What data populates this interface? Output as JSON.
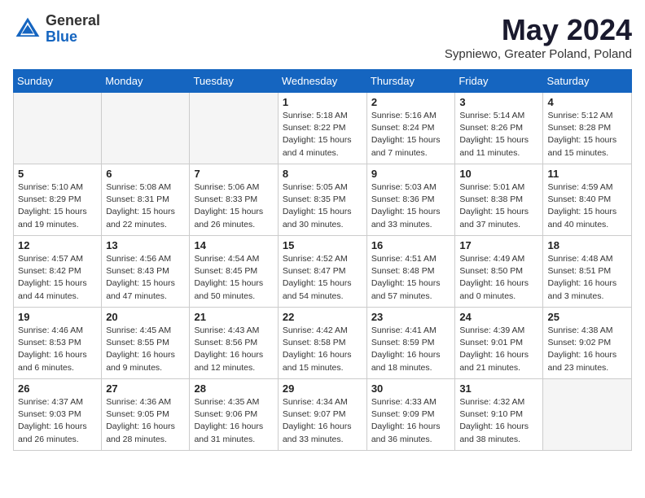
{
  "header": {
    "logo_general": "General",
    "logo_blue": "Blue",
    "month_title": "May 2024",
    "location": "Sypniewo, Greater Poland, Poland"
  },
  "weekdays": [
    "Sunday",
    "Monday",
    "Tuesday",
    "Wednesday",
    "Thursday",
    "Friday",
    "Saturday"
  ],
  "weeks": [
    [
      {
        "day": "",
        "info": ""
      },
      {
        "day": "",
        "info": ""
      },
      {
        "day": "",
        "info": ""
      },
      {
        "day": "1",
        "info": "Sunrise: 5:18 AM\nSunset: 8:22 PM\nDaylight: 15 hours\nand 4 minutes."
      },
      {
        "day": "2",
        "info": "Sunrise: 5:16 AM\nSunset: 8:24 PM\nDaylight: 15 hours\nand 7 minutes."
      },
      {
        "day": "3",
        "info": "Sunrise: 5:14 AM\nSunset: 8:26 PM\nDaylight: 15 hours\nand 11 minutes."
      },
      {
        "day": "4",
        "info": "Sunrise: 5:12 AM\nSunset: 8:28 PM\nDaylight: 15 hours\nand 15 minutes."
      }
    ],
    [
      {
        "day": "5",
        "info": "Sunrise: 5:10 AM\nSunset: 8:29 PM\nDaylight: 15 hours\nand 19 minutes."
      },
      {
        "day": "6",
        "info": "Sunrise: 5:08 AM\nSunset: 8:31 PM\nDaylight: 15 hours\nand 22 minutes."
      },
      {
        "day": "7",
        "info": "Sunrise: 5:06 AM\nSunset: 8:33 PM\nDaylight: 15 hours\nand 26 minutes."
      },
      {
        "day": "8",
        "info": "Sunrise: 5:05 AM\nSunset: 8:35 PM\nDaylight: 15 hours\nand 30 minutes."
      },
      {
        "day": "9",
        "info": "Sunrise: 5:03 AM\nSunset: 8:36 PM\nDaylight: 15 hours\nand 33 minutes."
      },
      {
        "day": "10",
        "info": "Sunrise: 5:01 AM\nSunset: 8:38 PM\nDaylight: 15 hours\nand 37 minutes."
      },
      {
        "day": "11",
        "info": "Sunrise: 4:59 AM\nSunset: 8:40 PM\nDaylight: 15 hours\nand 40 minutes."
      }
    ],
    [
      {
        "day": "12",
        "info": "Sunrise: 4:57 AM\nSunset: 8:42 PM\nDaylight: 15 hours\nand 44 minutes."
      },
      {
        "day": "13",
        "info": "Sunrise: 4:56 AM\nSunset: 8:43 PM\nDaylight: 15 hours\nand 47 minutes."
      },
      {
        "day": "14",
        "info": "Sunrise: 4:54 AM\nSunset: 8:45 PM\nDaylight: 15 hours\nand 50 minutes."
      },
      {
        "day": "15",
        "info": "Sunrise: 4:52 AM\nSunset: 8:47 PM\nDaylight: 15 hours\nand 54 minutes."
      },
      {
        "day": "16",
        "info": "Sunrise: 4:51 AM\nSunset: 8:48 PM\nDaylight: 15 hours\nand 57 minutes."
      },
      {
        "day": "17",
        "info": "Sunrise: 4:49 AM\nSunset: 8:50 PM\nDaylight: 16 hours\nand 0 minutes."
      },
      {
        "day": "18",
        "info": "Sunrise: 4:48 AM\nSunset: 8:51 PM\nDaylight: 16 hours\nand 3 minutes."
      }
    ],
    [
      {
        "day": "19",
        "info": "Sunrise: 4:46 AM\nSunset: 8:53 PM\nDaylight: 16 hours\nand 6 minutes."
      },
      {
        "day": "20",
        "info": "Sunrise: 4:45 AM\nSunset: 8:55 PM\nDaylight: 16 hours\nand 9 minutes."
      },
      {
        "day": "21",
        "info": "Sunrise: 4:43 AM\nSunset: 8:56 PM\nDaylight: 16 hours\nand 12 minutes."
      },
      {
        "day": "22",
        "info": "Sunrise: 4:42 AM\nSunset: 8:58 PM\nDaylight: 16 hours\nand 15 minutes."
      },
      {
        "day": "23",
        "info": "Sunrise: 4:41 AM\nSunset: 8:59 PM\nDaylight: 16 hours\nand 18 minutes."
      },
      {
        "day": "24",
        "info": "Sunrise: 4:39 AM\nSunset: 9:01 PM\nDaylight: 16 hours\nand 21 minutes."
      },
      {
        "day": "25",
        "info": "Sunrise: 4:38 AM\nSunset: 9:02 PM\nDaylight: 16 hours\nand 23 minutes."
      }
    ],
    [
      {
        "day": "26",
        "info": "Sunrise: 4:37 AM\nSunset: 9:03 PM\nDaylight: 16 hours\nand 26 minutes."
      },
      {
        "day": "27",
        "info": "Sunrise: 4:36 AM\nSunset: 9:05 PM\nDaylight: 16 hours\nand 28 minutes."
      },
      {
        "day": "28",
        "info": "Sunrise: 4:35 AM\nSunset: 9:06 PM\nDaylight: 16 hours\nand 31 minutes."
      },
      {
        "day": "29",
        "info": "Sunrise: 4:34 AM\nSunset: 9:07 PM\nDaylight: 16 hours\nand 33 minutes."
      },
      {
        "day": "30",
        "info": "Sunrise: 4:33 AM\nSunset: 9:09 PM\nDaylight: 16 hours\nand 36 minutes."
      },
      {
        "day": "31",
        "info": "Sunrise: 4:32 AM\nSunset: 9:10 PM\nDaylight: 16 hours\nand 38 minutes."
      },
      {
        "day": "",
        "info": ""
      }
    ]
  ]
}
